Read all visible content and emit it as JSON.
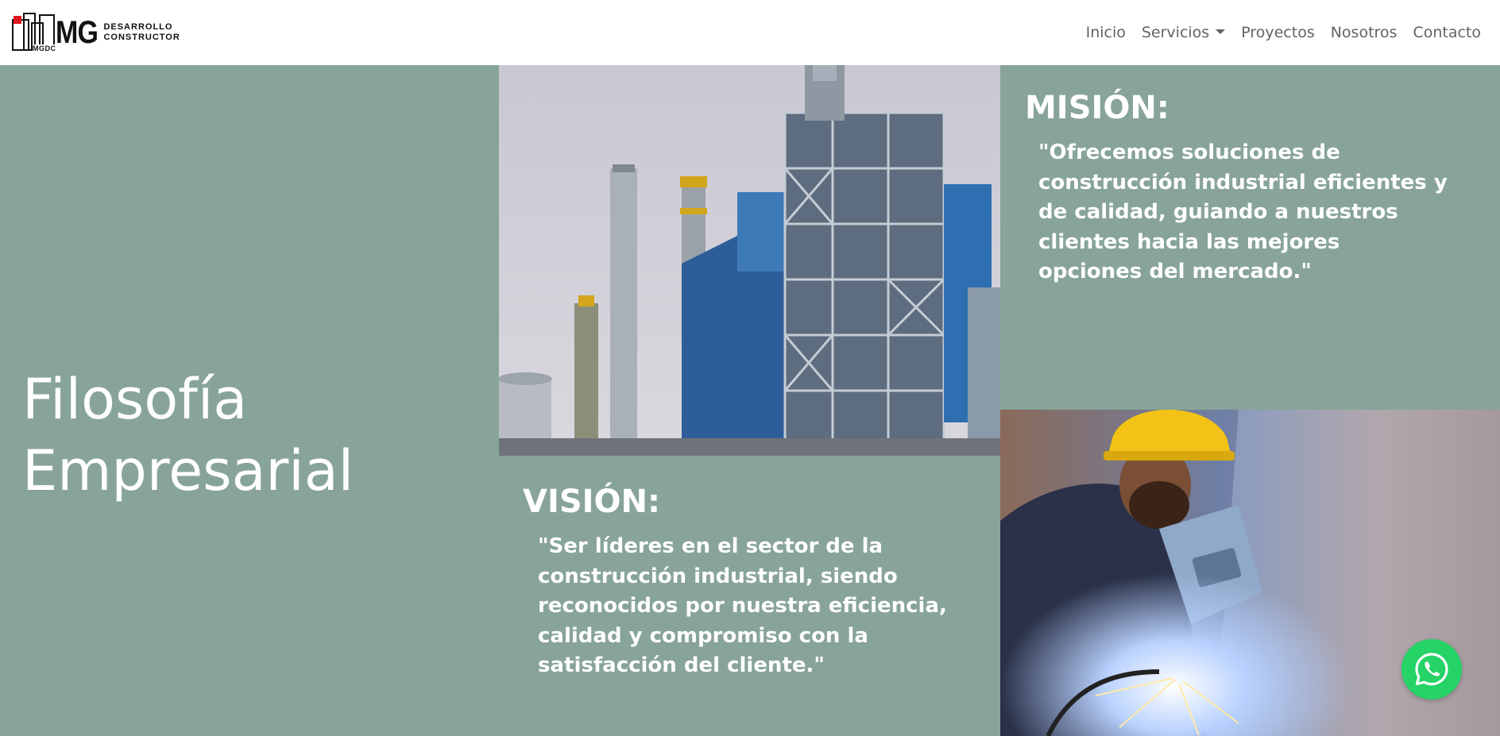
{
  "brand": {
    "logo_letters": "MGDC",
    "name_mark": "MG",
    "subtitle_line1": "DESARROLLO",
    "subtitle_line2": "CONSTRUCTOR",
    "accent_color": "#e0141e"
  },
  "nav": {
    "items": [
      {
        "label": "Inicio"
      },
      {
        "label": "Servicios",
        "has_dropdown": true
      },
      {
        "label": "Proyectos"
      },
      {
        "label": "Nosotros"
      },
      {
        "label": "Contacto"
      }
    ]
  },
  "philosophy": {
    "title": "Filosofía Empresarial",
    "background_color": "#88a498",
    "mission": {
      "heading": "MISIÓN:",
      "text": "\"Ofrecemos soluciones de construcción industrial eficientes y de calidad, guiando a nuestros clientes hacia las mejores opciones del mercado.\""
    },
    "vision": {
      "heading": "VISIÓN:",
      "text": "\"Ser líderes en el sector de la construcción industrial, siendo reconocidos por nuestra eficiencia, calidad y compromiso con la satisfacción del cliente.\""
    },
    "images": {
      "top": "industrial-refinery-photo",
      "bottom": "welder-at-work-photo"
    }
  },
  "whatsapp": {
    "icon": "whatsapp-icon",
    "color": "#25d366"
  }
}
